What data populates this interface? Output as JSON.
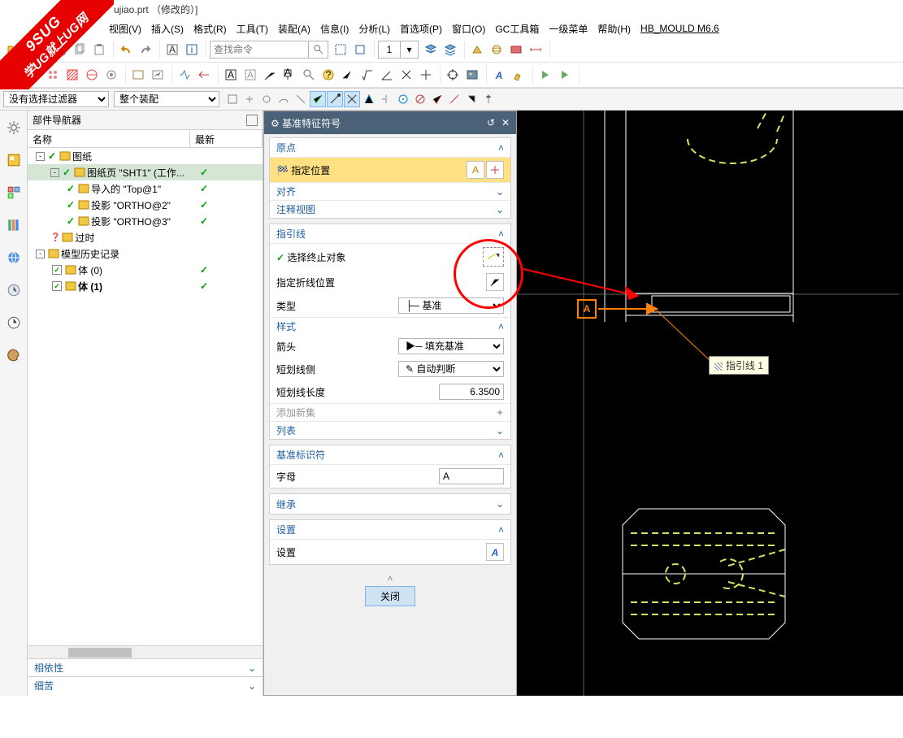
{
  "window": {
    "title": "ujiao.prt （修改的）]"
  },
  "menu": {
    "view": "视图(V)",
    "insert": "插入(S)",
    "format": "格式(R)",
    "tools": "工具(T)",
    "assembly": "装配(A)",
    "info": "信息(I)",
    "analysis": "分析(L)",
    "preferences": "首选项(P)",
    "window": "窗口(O)",
    "gctoolkit": "GC工具箱",
    "firstmenu": "一级菜单",
    "help": "帮助(H)",
    "hbmould": "HB_MOULD M6.6"
  },
  "toolbar": {
    "search_placeholder": "查找命令",
    "number_combo": "1"
  },
  "filter_row": {
    "filter1": "没有选择过滤器",
    "filter2": "整个装配"
  },
  "navigator": {
    "title": "部件导航器",
    "col_name": "名称",
    "col_latest": "最新",
    "tree": [
      {
        "depth": 0,
        "toggle": "-",
        "check": true,
        "label": "图纸",
        "latest": ""
      },
      {
        "depth": 1,
        "toggle": "-",
        "check": true,
        "label": "图纸页 \"SHT1\" (工作...",
        "latest": "✓",
        "selected": true
      },
      {
        "depth": 2,
        "toggle": "",
        "check": true,
        "label": "导入的 \"Top@1\"",
        "latest": "✓"
      },
      {
        "depth": 2,
        "toggle": "",
        "check": true,
        "label": "投影 \"ORTHO@2\"",
        "latest": "✓"
      },
      {
        "depth": 2,
        "toggle": "",
        "check": true,
        "label": "投影 \"ORTHO@3\"",
        "latest": "✓"
      },
      {
        "depth": 1,
        "toggle": "",
        "check": "?",
        "label": "过时",
        "latest": ""
      },
      {
        "depth": 0,
        "toggle": "-",
        "check": "",
        "label": "模型历史记录",
        "latest": ""
      },
      {
        "depth": 1,
        "toggle": "",
        "check": "box",
        "label": "体 (0)",
        "latest": "✓"
      },
      {
        "depth": 1,
        "toggle": "",
        "check": "box",
        "label": "体 (1)",
        "latest": "✓",
        "bold": true
      }
    ],
    "footer1": "相依性",
    "footer2": "细苦"
  },
  "dialog": {
    "title": "基准特征符号",
    "close_btn": "关闭",
    "origin": {
      "head": "原点",
      "specify_pos": "指定位置",
      "align": "对齐",
      "annot_view": "注释视图"
    },
    "leader": {
      "head": "指引线",
      "select_term": "选择终止对象",
      "spec_jog": "指定折线位置",
      "type_label": "类型",
      "type_value": "基准",
      "style_head": "样式",
      "arrow_label": "箭头",
      "arrow_value": "填充基准",
      "stub_side_label": "短划线侧",
      "stub_side_value": "自动判断",
      "stub_len_label": "短划线长度",
      "stub_len_value": "6.3500",
      "add_new": "添加新集",
      "list": "列表"
    },
    "datum_id": {
      "head": "基准标识符",
      "letter_label": "字母",
      "letter_value": "A"
    },
    "inherit": {
      "head": "继承"
    },
    "settings": {
      "head": "设置",
      "row": "设置"
    }
  },
  "canvas": {
    "tooltip": "指引线 1",
    "datum_letter": "A"
  },
  "watermark": {
    "line1": "9SUG",
    "line2": "学UG就上UG网"
  }
}
